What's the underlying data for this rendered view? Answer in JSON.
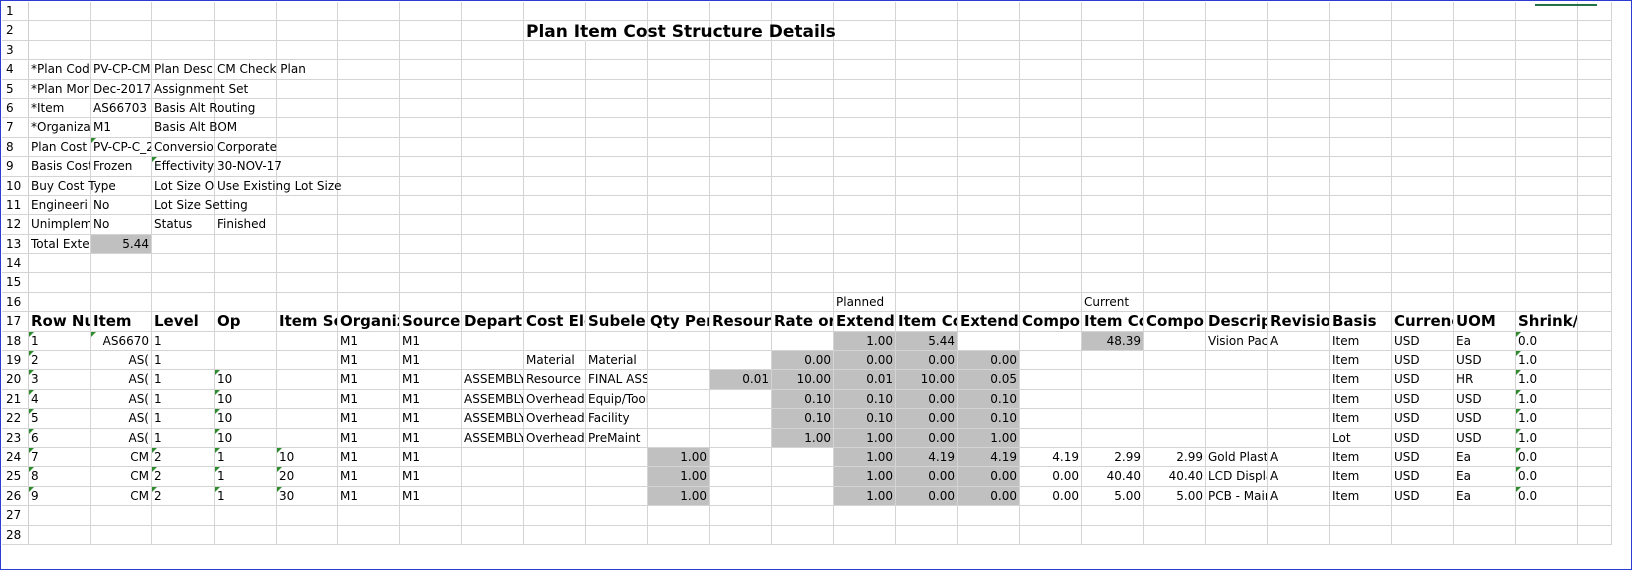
{
  "sheet": {
    "title": "Plan Item Cost Structure Details",
    "row_numbers": [
      "1",
      "2",
      "3",
      "4",
      "5",
      "6",
      "7",
      "8",
      "9",
      "10",
      "11",
      "12",
      "13",
      "14",
      "15",
      "16",
      "17",
      "18",
      "19",
      "20",
      "21",
      "22",
      "23",
      "24",
      "25",
      "26",
      "27",
      "28"
    ],
    "params": [
      {
        "label": "*Plan Cod",
        "value": "PV-CP-CM",
        "label2": "Plan Desc",
        "value2": "CM Check Plan"
      },
      {
        "label": "*Plan Mor",
        "value": "Dec-2017",
        "label2": "Assignment Set",
        "value2": ""
      },
      {
        "label": "*Item",
        "value": "AS66703",
        "label2": "Basis Alt Routing",
        "value2": ""
      },
      {
        "label": "*Organiza",
        "value": "M1",
        "label2": "Basis Alt BOM",
        "value2": ""
      },
      {
        "label": "Plan Cost",
        "value": "PV-CP-C_2",
        "label2": "Conversio",
        "value2": "Corporate"
      },
      {
        "label": "Basis Cost",
        "value": "Frozen",
        "label2": "Effectivity",
        "value2": "30-NOV-17"
      },
      {
        "label": "Buy Cost Type",
        "value": "",
        "label2": "Lot Size O",
        "value2": "Use Existing Lot Size"
      },
      {
        "label": "Engineeri",
        "value": "No",
        "label2": "Lot Size Setting",
        "value2": ""
      },
      {
        "label": "Unimplem",
        "value": "No",
        "label2": "Status",
        "value2": "Finished"
      },
      {
        "label": "Total Exte",
        "value": "5.44",
        "label2": "",
        "value2": ""
      }
    ],
    "group_labels": {
      "planned": "Planned",
      "current": "Current"
    },
    "headers": [
      "Row Nu",
      "Item",
      "Level",
      "Op",
      "Item Sec",
      "Organiz",
      "Source",
      "Departm",
      "Cost Ele",
      "Subelem",
      "Qty Per",
      "Resourc",
      "Rate or",
      "Extende",
      "Item Co",
      "Extende",
      "Compor",
      "Item Co",
      "Compor",
      "Descript",
      "Revisior",
      "Basis",
      "Currenc",
      "UOM",
      "Shrink/E"
    ],
    "rows": [
      [
        "1",
        "AS6670",
        "1",
        "",
        "",
        "M1",
        "M1",
        "",
        "",
        "",
        "",
        "",
        "",
        "1.00",
        "5.44",
        "",
        "",
        "48.39",
        "",
        "Vision Pac",
        "A",
        "Item",
        "USD",
        "Ea",
        "0.0"
      ],
      [
        "2",
        "AS(",
        "1",
        "",
        "",
        "M1",
        "M1",
        "",
        "Material",
        "Material",
        "",
        "",
        "0.00",
        "0.00",
        "0.00",
        "0.00",
        "",
        "",
        "",
        "",
        "",
        "Item",
        "USD",
        "USD",
        "1.0"
      ],
      [
        "3",
        "AS(",
        "1",
        "10",
        "",
        "M1",
        "M1",
        "ASSEMBLY",
        "Resource",
        "FINAL ASSM",
        "",
        "0.01",
        "10.00",
        "0.01",
        "10.00",
        "0.05",
        "",
        "",
        "",
        "",
        "",
        "Item",
        "USD",
        "HR",
        "1.0"
      ],
      [
        "4",
        "AS(",
        "1",
        "10",
        "",
        "M1",
        "M1",
        "ASSEMBLY",
        "Overhead",
        "Equip/Tool",
        "",
        "",
        "0.10",
        "0.10",
        "0.00",
        "0.10",
        "",
        "",
        "",
        "",
        "",
        "Item",
        "USD",
        "USD",
        "1.0"
      ],
      [
        "5",
        "AS(",
        "1",
        "10",
        "",
        "M1",
        "M1",
        "ASSEMBLY",
        "Overhead",
        "Facility",
        "",
        "",
        "0.10",
        "0.10",
        "0.00",
        "0.10",
        "",
        "",
        "",
        "",
        "",
        "Item",
        "USD",
        "USD",
        "1.0"
      ],
      [
        "6",
        "AS(",
        "1",
        "10",
        "",
        "M1",
        "M1",
        "ASSEMBLY",
        "Overhead",
        "PreMaint",
        "",
        "",
        "1.00",
        "1.00",
        "0.00",
        "1.00",
        "",
        "",
        "",
        "",
        "",
        "Lot",
        "USD",
        "USD",
        "1.0"
      ],
      [
        "7",
        "CM",
        "2",
        "1",
        "10",
        "M1",
        "M1",
        "",
        "",
        "",
        "1.00",
        "",
        "",
        "1.00",
        "4.19",
        "4.19",
        "4.19",
        "2.99",
        "2.99",
        "Gold Plast",
        "A",
        "Item",
        "USD",
        "Ea",
        "0.0"
      ],
      [
        "8",
        "CM",
        "2",
        "1",
        "20",
        "M1",
        "M1",
        "",
        "",
        "",
        "1.00",
        "",
        "",
        "1.00",
        "0.00",
        "0.00",
        "0.00",
        "40.40",
        "40.40",
        "LCD Displa",
        "A",
        "Item",
        "USD",
        "Ea",
        "0.0"
      ],
      [
        "9",
        "CM",
        "2",
        "1",
        "30",
        "M1",
        "M1",
        "",
        "",
        "",
        "1.00",
        "",
        "",
        "1.00",
        "0.00",
        "0.00",
        "0.00",
        "5.00",
        "5.00",
        "PCB - Mair",
        "A",
        "Item",
        "USD",
        "Ea",
        "0.0"
      ]
    ]
  },
  "colors": {
    "gray_fill": "#c0c0c0",
    "gridline": "#d4d4d4",
    "comment_marker": "#2e8b2e",
    "window_border": "#2b3bd4"
  }
}
